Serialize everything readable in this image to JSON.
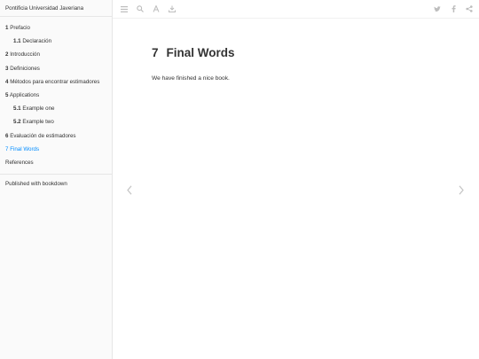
{
  "sidebar": {
    "title": "Pontificia Universidad Javeriana",
    "items": [
      {
        "num": "1",
        "label": "Prefacio",
        "level": 1
      },
      {
        "num": "1.1",
        "label": "Declaración",
        "level": 2
      },
      {
        "num": "2",
        "label": "Introducción",
        "level": 1
      },
      {
        "num": "3",
        "label": "Definiciones",
        "level": 1
      },
      {
        "num": "4",
        "label": "Métodos para encontrar estimadores",
        "level": 1
      },
      {
        "num": "5",
        "label": "Applications",
        "level": 1
      },
      {
        "num": "5.1",
        "label": "Example one",
        "level": 2
      },
      {
        "num": "5.2",
        "label": "Example two",
        "level": 2
      },
      {
        "num": "6",
        "label": "Evaluación de estimadores",
        "level": 1
      },
      {
        "num": "7",
        "label": "Final Words",
        "level": 1,
        "active": true
      },
      {
        "num": "",
        "label": "References",
        "level": 1
      }
    ],
    "published": "Published with bookdown"
  },
  "toolbar": {
    "left_icons": [
      "menu-icon",
      "search-icon",
      "font-icon",
      "edit-icon"
    ],
    "right_icons": [
      "twitter-icon",
      "facebook-icon",
      "share-icon"
    ]
  },
  "content": {
    "chapter_number": "7",
    "chapter_title": "Final Words",
    "paragraph": "We have finished a nice book."
  },
  "colors": {
    "active_link": "#008cff",
    "icon": "#bdbdbd",
    "sidebar_bg": "#fafafa"
  }
}
